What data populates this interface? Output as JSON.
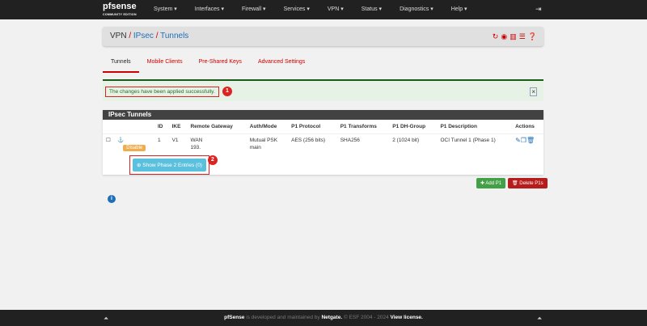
{
  "nav": {
    "logo": "pfsense",
    "logo_sub": "COMMUNITY EDITION",
    "menu": [
      "System ▾",
      "Interfaces ▾",
      "Firewall ▾",
      "Services ▾",
      "VPN ▾",
      "Status ▾",
      "Diagnostics ▾",
      "Help ▾"
    ]
  },
  "breadcrumb": {
    "root": "VPN",
    "mid": "IPsec",
    "current": "Tunnels",
    "sep": "/"
  },
  "tabs": [
    "Tunnels",
    "Mobile Clients",
    "Pre-Shared Keys",
    "Advanced Settings"
  ],
  "alert": {
    "message": "The changes have been applied successfully.",
    "badge": "1",
    "close": "×"
  },
  "panel": {
    "title": "IPsec Tunnels",
    "headers": [
      "",
      "",
      "ID",
      "IKE",
      "Remote Gateway",
      "Auth/Mode",
      "P1 Protocol",
      "P1 Transforms",
      "P1 DH-Group",
      "P1 Description",
      "Actions"
    ],
    "row": {
      "status": "Disable",
      "id": "1",
      "ike": "V1",
      "gw1": "WAN",
      "gw2": "193.",
      "auth1": "Mutual PSK",
      "auth2": "main",
      "proto": "AES (256 bits)",
      "trans": "SHA256",
      "dh": "2 (1024 bit)",
      "desc": "OCI Tunnel 1 (Phase 1)"
    },
    "phase2_button": "Show Phase 2 Entries (0)",
    "badge2": "2"
  },
  "buttons": {
    "add": "Add P1",
    "delete": "Delete P1s"
  },
  "footer": {
    "brand": "pfSense",
    "text1": " is developed and maintained by ",
    "netgate": "Netgate.",
    "text2": " © ESF 2004 - 2024 ",
    "license": "View license."
  },
  "colors": {
    "accent": "#cc0000",
    "navbar": "#212121",
    "success": "#2b6b2b",
    "info": "#5bc0de",
    "warning": "#f0ad4e"
  }
}
